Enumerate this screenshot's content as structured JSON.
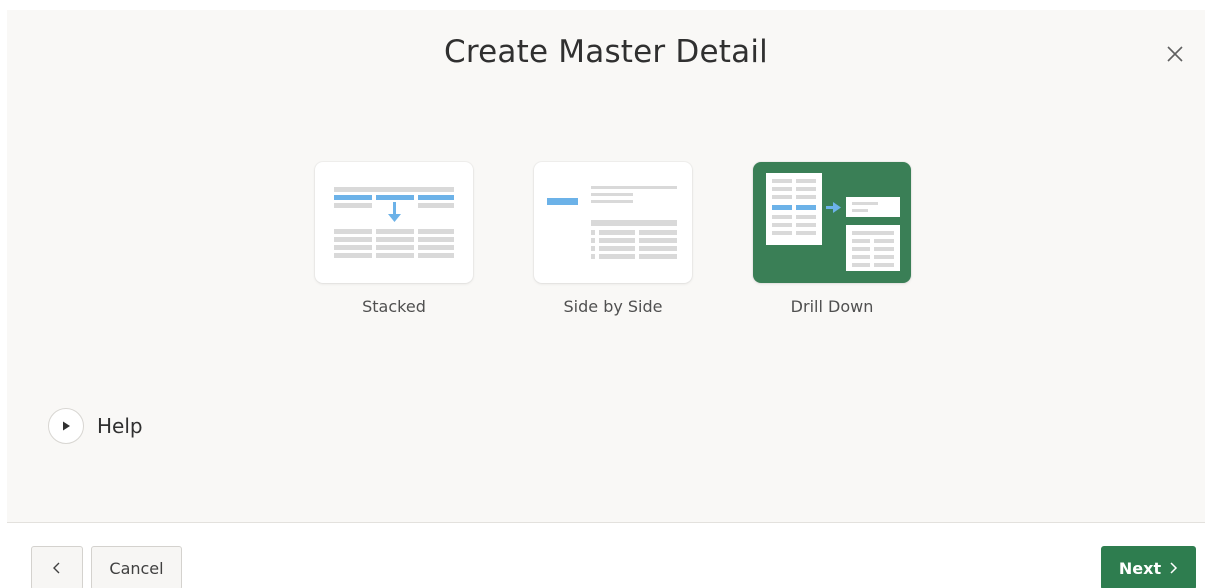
{
  "dialog": {
    "title": "Create Master Detail",
    "close_icon": "close-icon"
  },
  "options": [
    {
      "label": "Stacked",
      "icon": "stacked-layout-icon",
      "selected": false
    },
    {
      "label": "Side by Side",
      "icon": "side-by-side-layout-icon",
      "selected": false
    },
    {
      "label": "Drill Down",
      "icon": "drill-down-layout-icon",
      "selected": true
    }
  ],
  "help": {
    "label": "Help",
    "icon": "play-triangle-icon"
  },
  "footer": {
    "back_icon": "chevron-left-icon",
    "cancel_label": "Cancel",
    "next_label": "Next",
    "next_icon": "chevron-right-icon"
  },
  "colors": {
    "accent": "#2e7d4f",
    "selected_card": "#3a7f56",
    "highlight_blue": "#6cb2e8",
    "grid_gray": "#d9d9d9",
    "background": "#f9f8f6"
  }
}
